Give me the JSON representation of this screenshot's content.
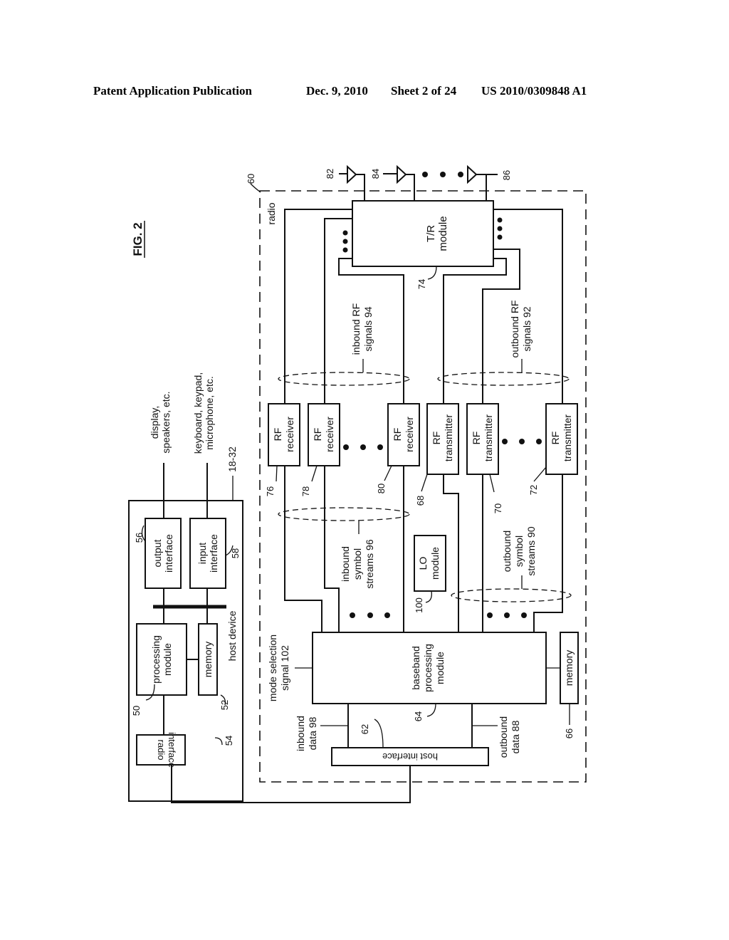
{
  "header": {
    "publication": "Patent Application Publication",
    "date": "Dec. 9, 2010",
    "sheet": "Sheet 2 of 24",
    "number": "US 2010/0309848 A1"
  },
  "figure": {
    "title": "FIG. 2",
    "host_device": {
      "label": "host device",
      "ref": "18-32",
      "radio_interface": {
        "line1": "radio",
        "line2": "interface",
        "ref": "54"
      },
      "processing_module": {
        "line1": "processing",
        "line2": "module",
        "ref": "50"
      },
      "memory": {
        "label": "memory",
        "ref": "52"
      },
      "output_interface": {
        "line1": "output",
        "line2": "interface",
        "ref": "56"
      },
      "input_interface": {
        "line1": "input",
        "line2": "interface",
        "ref": "58"
      },
      "output_devices": {
        "line1": "display,",
        "line2": "speakers, etc."
      },
      "input_devices": {
        "line1": "keyboard, keypad,",
        "line2": "microphone, etc."
      }
    },
    "radio": {
      "label": "radio",
      "ref": "60",
      "host_interface": {
        "label": "host interface",
        "ref": "62"
      },
      "baseband": {
        "line1": "baseband",
        "line2": "processing",
        "line3": "module",
        "ref": "64"
      },
      "memory": {
        "label": "memory",
        "ref": "66"
      },
      "mode_selection": {
        "line1": "mode selection",
        "line2": "signal 102"
      },
      "inbound_data": {
        "line1": "inbound",
        "line2": "data 98"
      },
      "outbound_data": {
        "line1": "outbound",
        "line2": "data 88"
      },
      "lo_module": {
        "line1": "LO",
        "line2": "module",
        "ref": "100"
      },
      "inbound_symbol": {
        "line1": "inbound",
        "line2": "symbol",
        "line3": "streams 96"
      },
      "outbound_symbol": {
        "line1": "outbound",
        "line2": "symbol",
        "line3": "streams 90"
      },
      "inbound_rf": {
        "line1": "inbound RF",
        "line2": "signals 94"
      },
      "outbound_rf": {
        "line1": "outbound RF",
        "line2": "signals 92"
      },
      "tr_module": {
        "line1": "T/R",
        "line2": "module",
        "ref": "74"
      },
      "receivers": [
        {
          "line1": "RF",
          "line2": "receiver",
          "ref": "76"
        },
        {
          "line1": "RF",
          "line2": "receiver",
          "ref": "78"
        },
        {
          "line1": "RF",
          "line2": "receiver",
          "ref": "80"
        }
      ],
      "transmitters": [
        {
          "line1": "RF",
          "line2": "transmitter",
          "ref": "68"
        },
        {
          "line1": "RF",
          "line2": "transmitter",
          "ref": "70"
        },
        {
          "line1": "RF",
          "line2": "transmitter",
          "ref": "72"
        }
      ],
      "antennas": [
        {
          "ref": "82"
        },
        {
          "ref": "84"
        },
        {
          "ref": "86"
        }
      ]
    }
  }
}
